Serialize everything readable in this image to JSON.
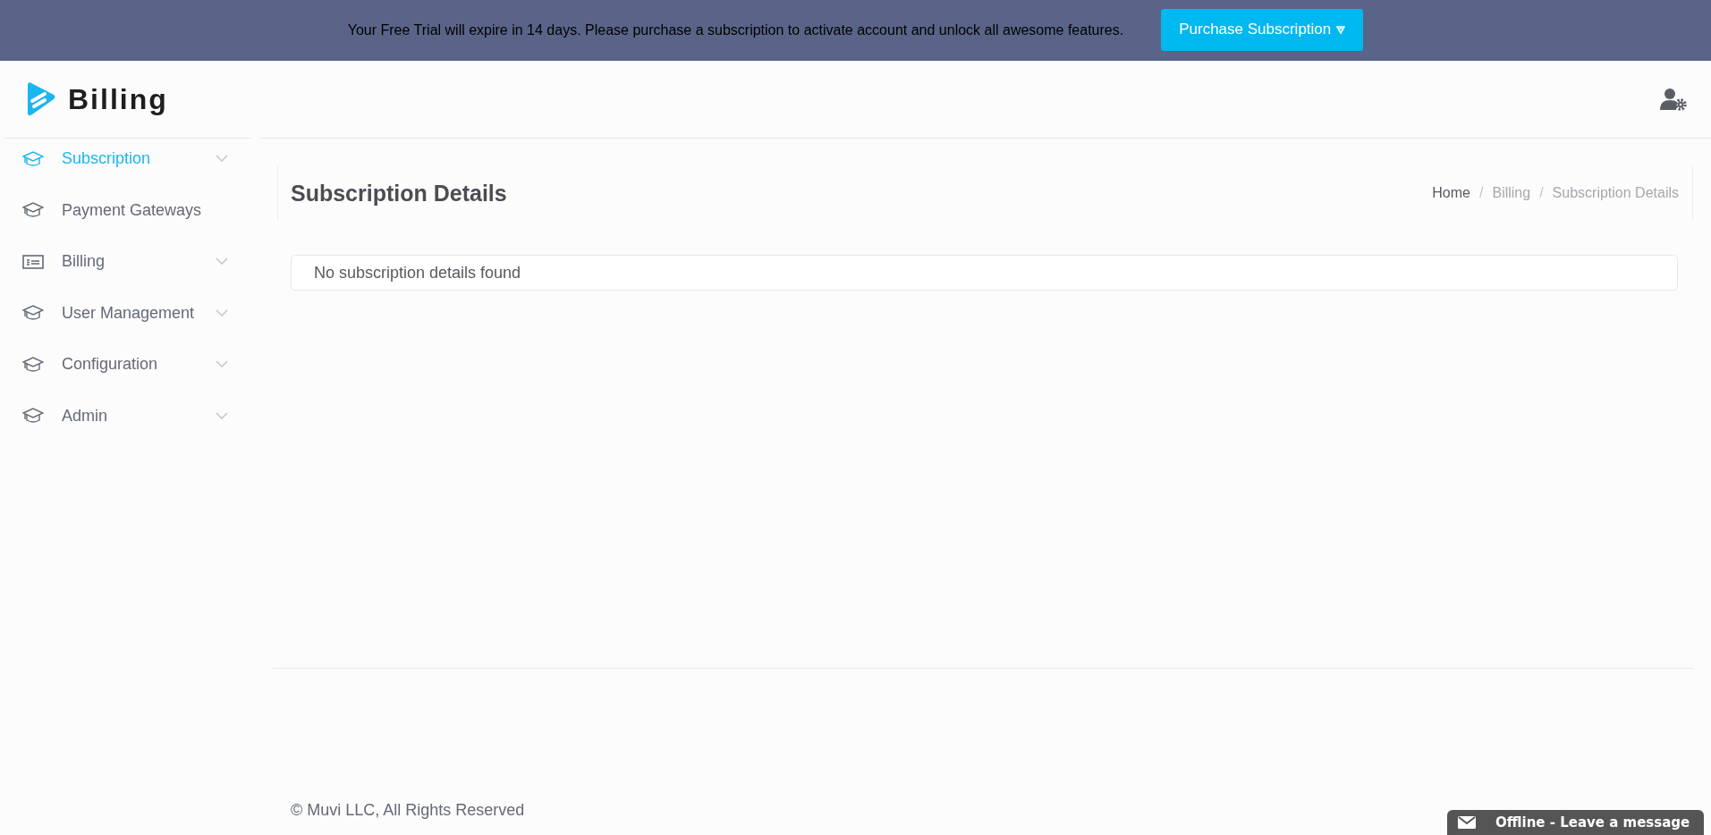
{
  "banner": {
    "message": "Your Free Trial will expire in 14 days. Please purchase a subscription to activate account and unlock all awesome features.",
    "button": "Purchase Subscription"
  },
  "logo": {
    "title": "Billing"
  },
  "sidebar": {
    "items": [
      {
        "label": "Subscription",
        "kind": "cap",
        "has_submenu": true,
        "selected": true
      },
      {
        "label": "Payment Gateways",
        "kind": "cap",
        "has_submenu": false,
        "selected": false
      },
      {
        "label": "Billing",
        "kind": "bill",
        "has_submenu": true,
        "selected": false
      },
      {
        "label": "User Management",
        "kind": "cap",
        "has_submenu": true,
        "selected": false
      },
      {
        "label": "Configuration",
        "kind": "cap",
        "has_submenu": true,
        "selected": false
      },
      {
        "label": "Admin",
        "kind": "cap",
        "has_submenu": true,
        "selected": false
      }
    ]
  },
  "page": {
    "title": "Subscription Details",
    "breadcrumbs": [
      {
        "kind": "link",
        "label": "Home"
      },
      {
        "kind": "separator",
        "label": "/"
      },
      {
        "kind": "link",
        "label": "Billing"
      },
      {
        "kind": "separator",
        "label": "/"
      },
      {
        "kind": "link",
        "label": "Subscription Details"
      }
    ],
    "empty_message": "No subscription details found"
  },
  "footer": {
    "text": "© Muvi LLC, All Rights Reserved"
  },
  "chat": {
    "label": "Offline - Leave a message"
  }
}
